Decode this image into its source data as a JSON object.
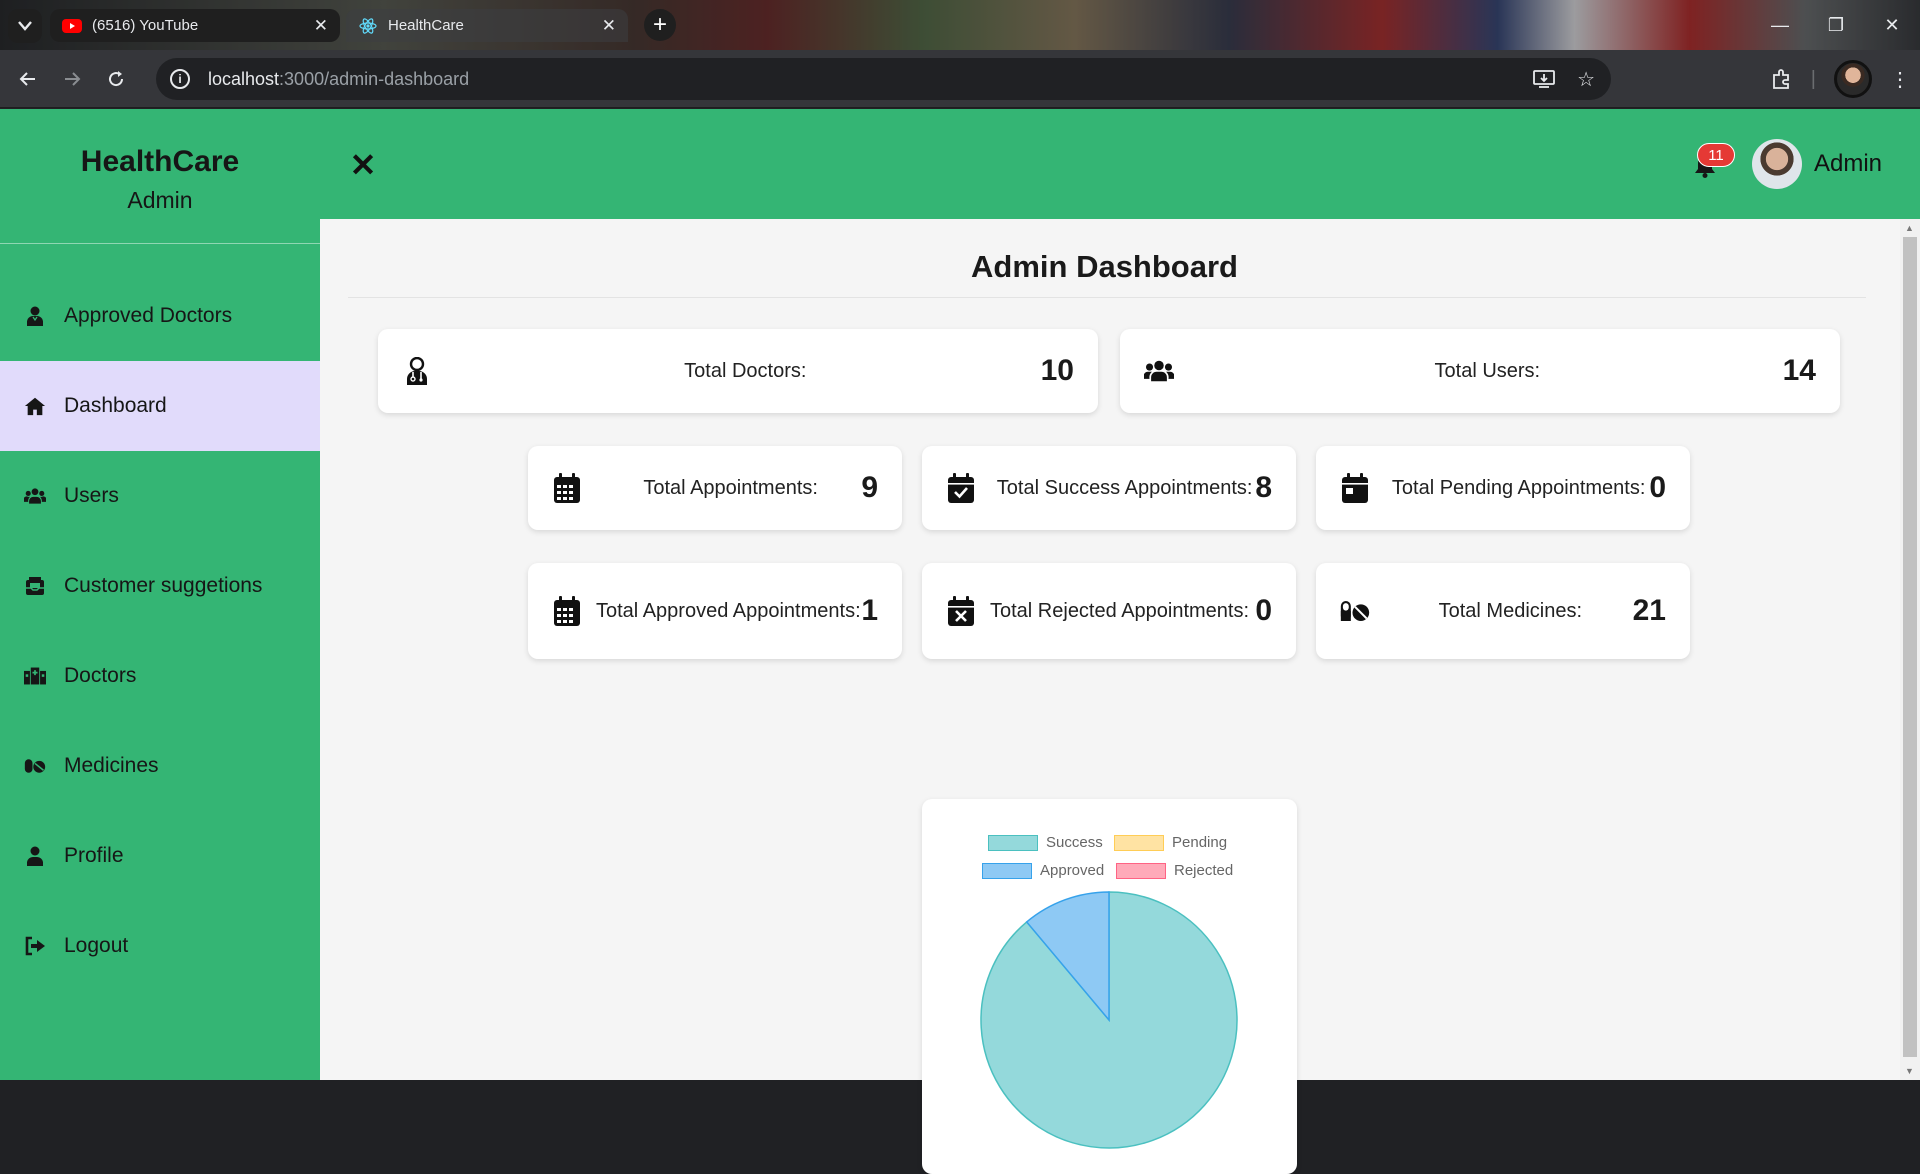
{
  "browser": {
    "tabs": [
      {
        "title": "(6516) YouTube",
        "icon": "youtube-icon"
      },
      {
        "title": "HealthCare",
        "icon": "react-icon"
      }
    ],
    "close_glyph": "✕",
    "new_tab_glyph": "+",
    "url_host": "localhost",
    "url_path": ":3000/admin-dashboard"
  },
  "sidebar": {
    "brand": "HealthCare",
    "role": "Admin",
    "items": [
      {
        "label": "Approved Doctors",
        "icon": "doctor-icon"
      },
      {
        "label": "Dashboard",
        "icon": "home-icon",
        "active": true
      },
      {
        "label": "Users",
        "icon": "users-icon"
      },
      {
        "label": "Customer suggetions",
        "icon": "inbox-icon"
      },
      {
        "label": "Doctors",
        "icon": "hospital-icon"
      },
      {
        "label": "Medicines",
        "icon": "pills-icon"
      },
      {
        "label": "Profile",
        "icon": "user-icon"
      },
      {
        "label": "Logout",
        "icon": "logout-icon"
      }
    ]
  },
  "topbar": {
    "close_glyph": "✕",
    "notification_count": "11",
    "user_name": "Admin"
  },
  "dashboard": {
    "title": "Admin Dashboard",
    "total_doctors": {
      "label": "Total Doctors:",
      "value": "10"
    },
    "total_users": {
      "label": "Total Users:",
      "value": "14"
    },
    "total_appointments": {
      "label": "Total Appointments:",
      "value": "9"
    },
    "total_success": {
      "label": "Total Success Appointments:",
      "value": "8"
    },
    "total_pending": {
      "label": "Total Pending Appointments:",
      "value": "0"
    },
    "total_approved": {
      "label": "Total Approved Appointments:",
      "value": "1"
    },
    "total_rejected": {
      "label": "Total Rejected Appointments:",
      "value": "0"
    },
    "total_medicines": {
      "label": "Total Medicines:",
      "value": "21"
    }
  },
  "chart_data": {
    "type": "pie",
    "categories": [
      "Success",
      "Pending",
      "Approved",
      "Rejected"
    ],
    "values": [
      8,
      0,
      1,
      0
    ],
    "colors": [
      "#94d9db",
      "#ffe3a3",
      "#8ec9f4",
      "#ffaab9"
    ],
    "borders": [
      "#4bc0c0",
      "#ffcd56",
      "#36a2eb",
      "#ff6384"
    ],
    "legend": "top"
  },
  "colors": {
    "brand_green": "#34b574",
    "active_item": "#e1dbfb",
    "badge_red": "#e53935"
  }
}
